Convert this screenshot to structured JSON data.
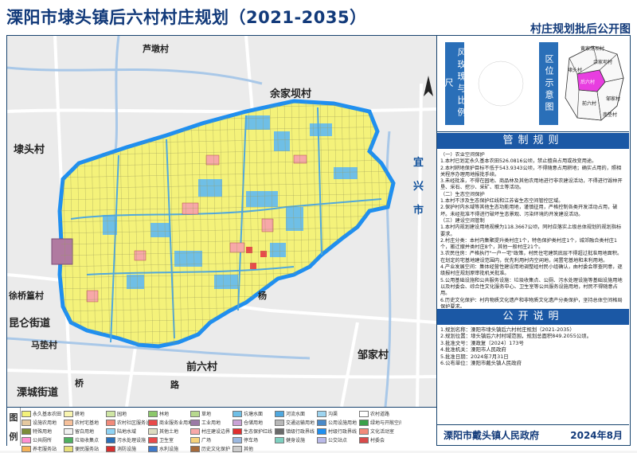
{
  "header": {
    "title": "溧阳市埭头镇后六村村庄规划（2021-2035）",
    "subtitle": "村庄规划批后公开图"
  },
  "map": {
    "places": {
      "ludun": "芦墩村",
      "yujiaba": "余家坝村",
      "daitou": "埭头村",
      "yixing_1": "宜",
      "yixing_2": "兴",
      "yixing_3": "市",
      "xuqiao": "徐桥篁村",
      "kunlun": "昆仑街道",
      "madeng": "马垫村",
      "licheng": "溧城街道",
      "qianliu": "前六村",
      "zoujiaci": "邹家村",
      "qiao": "桥",
      "yang": "杨",
      "lu": "路"
    },
    "colors": {
      "village_land": "#f4f27a",
      "water": "#6fbfe6",
      "boundary": "#1f8ff0",
      "road": "#ffffff",
      "construction": "#f7a8a8",
      "industrial": "#9b7aa6",
      "background": "#ebebeb"
    }
  },
  "legend": {
    "head": [
      "图",
      "例"
    ],
    "items": [
      {
        "label": "永久基本农田",
        "color": "#f4f27a"
      },
      {
        "label": "耕地",
        "color": "#f9f5b0"
      },
      {
        "label": "园地",
        "color": "#cfe6a4"
      },
      {
        "label": "林地",
        "color": "#8cc86b"
      },
      {
        "label": "草地",
        "color": "#b7d98e"
      },
      {
        "label": "坑塘水面",
        "color": "#6fbfe6"
      },
      {
        "label": "河流水面",
        "color": "#4fa8df"
      },
      {
        "label": "沟渠",
        "color": "#9dd4f0"
      },
      {
        "label": "农村道路",
        "color": "#ffffff"
      },
      {
        "label": "设施农用地",
        "color": "#e5c9a0"
      },
      {
        "label": "农村宅基地",
        "color": "#f7c19b"
      },
      {
        "label": "农村社区服务设施用地",
        "color": "#f28a7a"
      },
      {
        "label": "商业服务业用地",
        "color": "#e84a4a"
      },
      {
        "label": "工业用地",
        "color": "#9b7aa6"
      },
      {
        "label": "仓储用地",
        "color": "#c9a3d6"
      },
      {
        "label": "交通运输用地",
        "color": "#b8b8b8"
      },
      {
        "label": "公用设施用地",
        "color": "#4a8ac9"
      },
      {
        "label": "绿地与开敞空间",
        "color": "#3aa04a"
      },
      {
        "label": "特殊用地",
        "color": "#7d8c3a"
      },
      {
        "label": "留白用地",
        "color": "#f0f0f0"
      },
      {
        "label": "陆地水域",
        "color": "#8fd3f5"
      },
      {
        "label": "其他土地",
        "color": "#dcdcc0"
      },
      {
        "label": "村庄建设边界",
        "color": "#f7a8a8"
      },
      {
        "label": "生态保护红线",
        "color": "#e02f2f"
      },
      {
        "label": "镇级行政界线",
        "color": "#6a6a6a"
      },
      {
        "label": "村级行政界线",
        "color": "#1f8ff0"
      },
      {
        "label": "文化活动室",
        "color": "#f28a7a"
      },
      {
        "label": "公共厕所",
        "color": "#ff8fd2"
      },
      {
        "label": "垃圾收集点",
        "color": "#4fb060"
      },
      {
        "label": "污水处理设施",
        "color": "#2a6fb8"
      },
      {
        "label": "卫生室",
        "color": "#e84a4a"
      },
      {
        "label": "广场",
        "color": "#f6d27a"
      },
      {
        "label": "停车场",
        "color": "#9bb8e0"
      },
      {
        "label": "健身设施",
        "color": "#7ed0c0"
      },
      {
        "label": "公交站点",
        "color": "#b9b9e8"
      },
      {
        "label": "村委会",
        "color": "#d94b4b"
      },
      {
        "label": "养老服务站",
        "color": "#f5b35a"
      },
      {
        "label": "便民服务站",
        "color": "#e8e07a"
      },
      {
        "label": "消防设施",
        "color": "#d62f2f"
      },
      {
        "label": "水利设施",
        "color": "#3e78c8"
      },
      {
        "label": "历史文化保护",
        "color": "#a66a3a"
      },
      {
        "label": "其他",
        "color": "#cccccc"
      }
    ]
  },
  "side": {
    "scale_label": "风玫瑰与比例尺",
    "location_label": "区位示意图",
    "mini_map": {
      "labels": {
        "huangtang": "黄家荡坝村",
        "yujiaba": "余家坝村",
        "daitou": "埭头村",
        "houliu": "后六村",
        "qianliu": "前六村",
        "zoujia": "邹家村",
        "nanhu": "南垫村"
      },
      "highlight_color": "#e83ee0"
    },
    "rules_title": "管制规则",
    "rules": [
      "（一）农业空间保护",
      "1.本村已划定永久基本农田526.0816公顷，禁止擅自占用或改变用途。",
      "2.本村耕地保护目标不低于543.9343公顷，不得随意占用耕地；确实占用的，照相关程序办理用地报批手续。",
      "3.未经批准，不得在园地、商品林及其他农用地进行非农建设活动，不得进行毁林开垦、采石、挖沙、采矿、取土等活动。",
      "（二）生态空间保护",
      "1.本村不涉及生态保护红线和江苏省生态空间管控区域。",
      "2.保护村内水域等其他生态功能用地，谨慎征用，严格控制各类开发活动占用，破坏。未经批准不得进行破坏生态景观、污染环境的开发建设活动。",
      "（三）建设空间管制",
      "1.本村内规划建设用地规模为118.3667公顷，同时应落实上级总体规划的规划指标要求。",
      "2.村庄分类：本村内集聚提升类村庄1个，特色保护类村庄1个，城郊融合类村庄1个，搬迁撤并类村庄8个，其他一般村庄21个。",
      "3.农民住房：严格执行\"一户一宅\"政策，村民住宅建筑底层不得超过批准用地面积。在划定的宅基地建设范围内，优先利用村内空闲地，闲置宅基地和未利用地。",
      "4.产业发展空间：集体经营性建设用地调整经村民小组确认，由村委会审查同意，逐级报村庄规划原审批机关批准。",
      "5.公用基础设施和公共服务设施：垃圾收集点、公厕、污水处理设施等基础设施用地以及村委会、综合性文化服务中心、卫生室等公共服务设施用地，村民不得随意占用。",
      "6.历史文化保护：村内物质文化遗产和非物质文化遗产分类保护，坚持总体空间格局保护要求。"
    ],
    "notice_title": "公开说明",
    "notice": [
      "1.规划名称：溧阳市埭头镇后六村村庄规划（2021-2035）",
      "2.规划位置：埭头镇后六村村域范围，规划总面积849.2055公顷。",
      "3.批准文号：溧政复〔2024〕173号",
      "4.批准机关：溧阳市人民政府",
      "5.批准日期：2024年7月31日",
      "6.公布单位：溧阳市戴头镇人民政府"
    ],
    "footer_agency": "溧阳市戴头镇人民政府",
    "footer_date": "2024年8月"
  }
}
